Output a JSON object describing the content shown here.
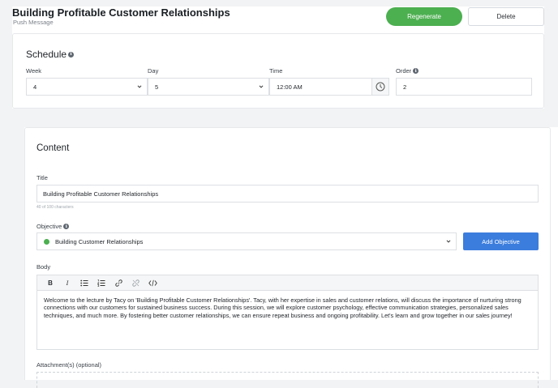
{
  "header": {
    "title": "Building Profitable Customer Relationships",
    "subtitle": "Push Message",
    "regenerate_label": "Regenerate",
    "delete_label": "Delete"
  },
  "schedule": {
    "title": "Schedule",
    "week": {
      "label": "Week",
      "value": "4"
    },
    "day": {
      "label": "Day",
      "value": "5"
    },
    "time": {
      "label": "Time",
      "value": "12:00 AM"
    },
    "order": {
      "label": "Order",
      "value": "2"
    }
  },
  "content": {
    "heading": "Content",
    "title_label": "Title",
    "title_value": "Building Profitable Customer Relationships",
    "char_count": "40 of 100 characters",
    "objective_label": "Objective",
    "objective_value": "Building Customer Relationships",
    "add_objective_label": "Add Objective",
    "body_label": "Body",
    "toolbar": {
      "bold": "B",
      "italic": "I"
    },
    "body_text": "Welcome to the lecture by Tacy on 'Building Profitable Customer Relationships'. Tacy, with her expertise in sales and customer relations, will discuss the importance of nurturing strong connections with our customers for sustained business success. During this session, we will explore customer psychology, effective communication strategies, personalized sales techniques, and much more. By fostering better customer relationships, we can ensure repeat business and ongoing profitability. Let's learn and grow together in our sales journey!",
    "attachments_label": "Attachment(s) (optional)"
  },
  "colors": {
    "accent_green": "#4caf50",
    "accent_blue": "#3b7ddd"
  }
}
